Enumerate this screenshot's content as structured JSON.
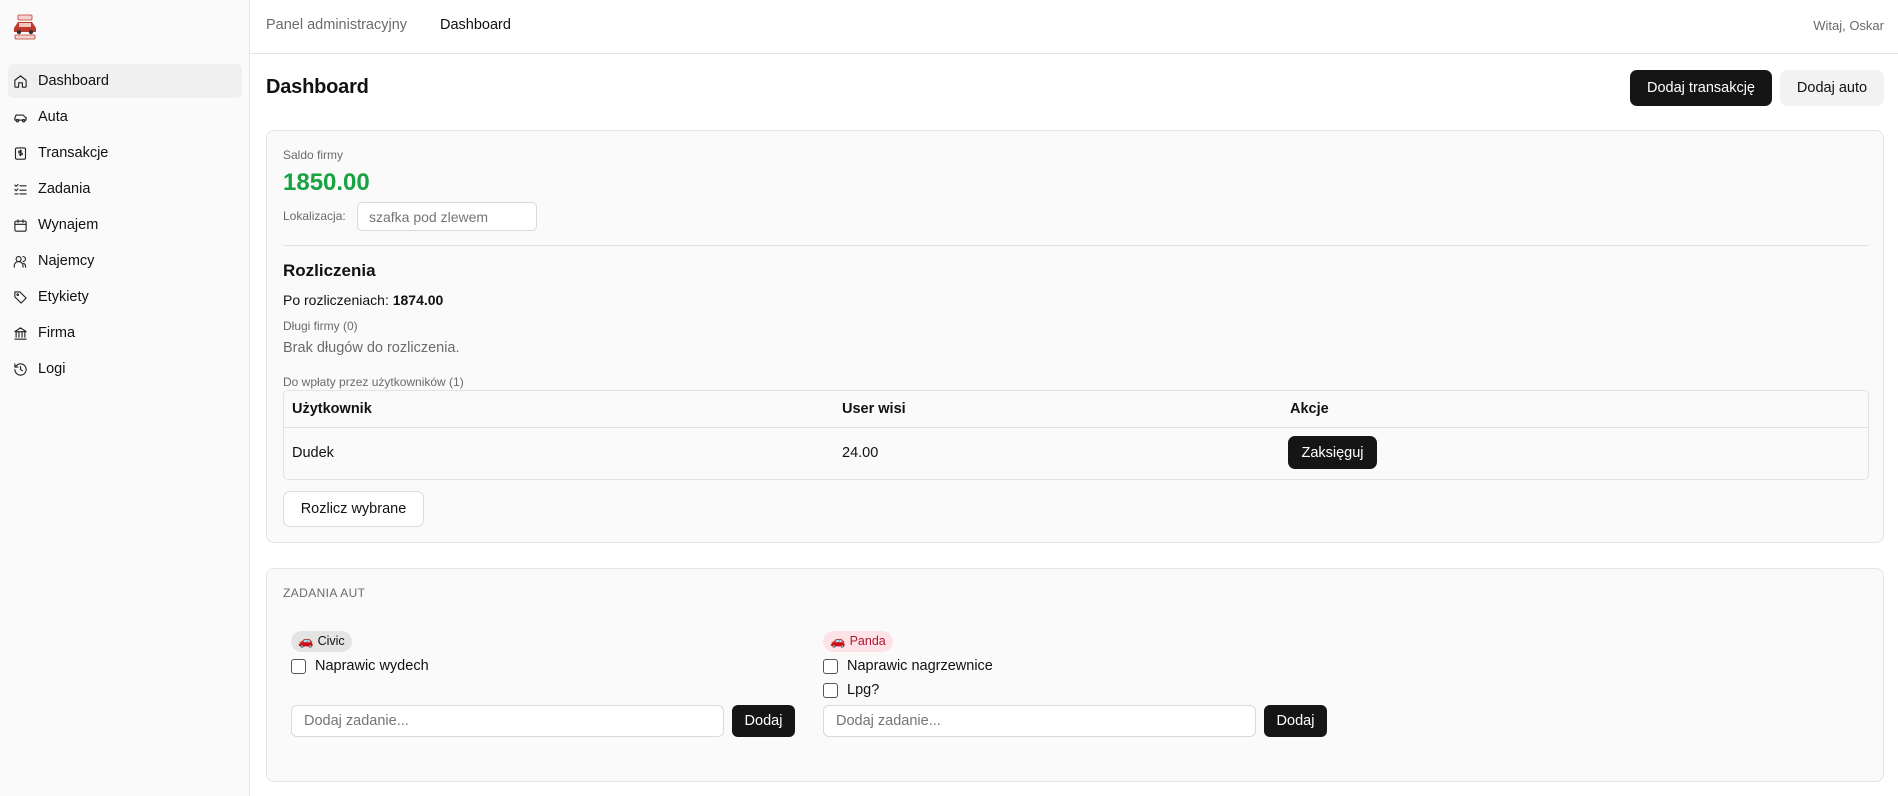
{
  "sidebar": {
    "items": [
      {
        "label": "Dashboard",
        "icon": "home-icon",
        "active": true
      },
      {
        "label": "Auta",
        "icon": "car-icon",
        "active": false
      },
      {
        "label": "Transakcje",
        "icon": "receipt-icon",
        "active": false
      },
      {
        "label": "Zadania",
        "icon": "task-list-icon",
        "active": false
      },
      {
        "label": "Wynajem",
        "icon": "calendar-icon",
        "active": false
      },
      {
        "label": "Najemcy",
        "icon": "users-icon",
        "active": false
      },
      {
        "label": "Etykiety",
        "icon": "tag-icon",
        "active": false
      },
      {
        "label": "Firma",
        "icon": "bank-icon",
        "active": false
      },
      {
        "label": "Logi",
        "icon": "history-icon",
        "active": false
      }
    ]
  },
  "header": {
    "breadcrumb_1": "Panel administracyjny",
    "breadcrumb_2": "Dashboard",
    "greeting": "Witaj, Oskar"
  },
  "main": {
    "title": "Dashboard",
    "add_transaction_label": "Dodaj transakcję",
    "add_car_label": "Dodaj auto"
  },
  "balance": {
    "label": "Saldo firmy",
    "value": "1850.00",
    "location_label": "Lokalizacja:",
    "location_placeholder": "szafka pod zlewem"
  },
  "settlements": {
    "title": "Rozliczenia",
    "after_label": "Po rozliczeniach:",
    "after_value": "1874.00",
    "debts_label": "Długi firmy (0)",
    "no_debts_text": "Brak długów do rozliczenia.",
    "to_pay_label": "Do wpłaty przez użytkowników (1)",
    "columns": [
      "Użytkownik",
      "User wisi",
      "Akcje"
    ],
    "rows": [
      {
        "user": "Dudek",
        "amount": "24.00",
        "action": "Zaksięguj"
      }
    ],
    "settle_selected_label": "Rozlicz wybrane"
  },
  "car_tasks": {
    "title": "ZADANIA AUT",
    "cars": [
      {
        "name": "Civic",
        "emoji": "🚗",
        "tasks": [
          "Naprawic wydech"
        ],
        "input_placeholder": "Dodaj zadanie...",
        "add_label": "Dodaj"
      },
      {
        "name": "Panda",
        "emoji": "🚗",
        "tasks": [
          "Naprawic nagrzewnice",
          "Lpg?"
        ],
        "input_placeholder": "Dodaj zadanie...",
        "add_label": "Dodaj"
      }
    ]
  },
  "colors": {
    "accent_dark": "#151515",
    "balance_green": "#18a343",
    "panda_badge_bg": "#fde3e8",
    "panda_badge_text": "#b01535"
  }
}
